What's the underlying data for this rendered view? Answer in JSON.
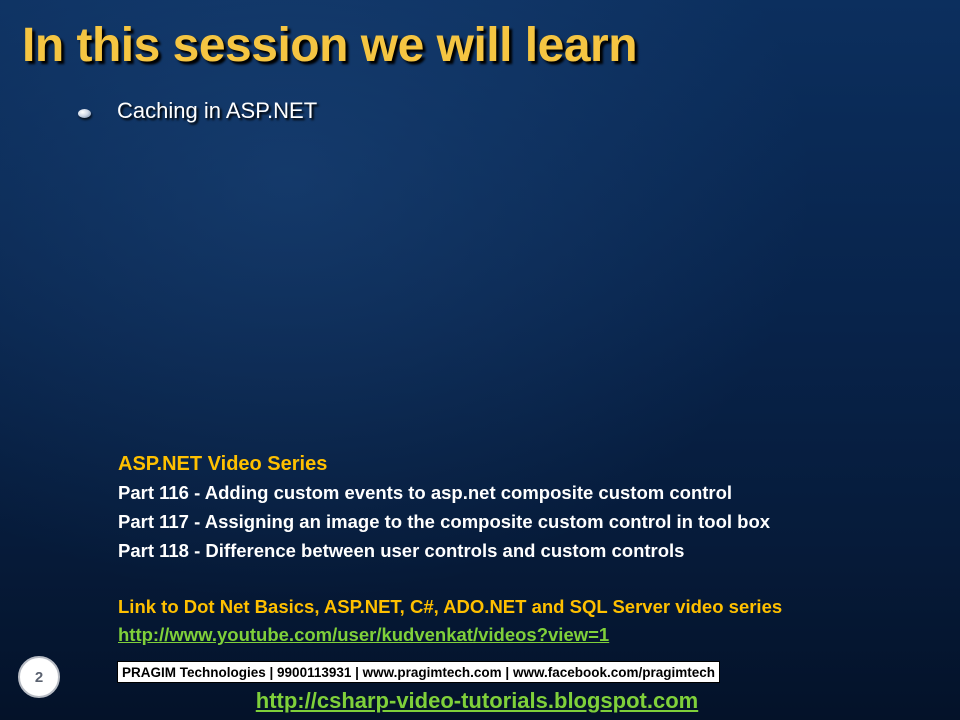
{
  "slide": {
    "title": "In this session we will learn",
    "bullets": [
      "Caching in ASP.NET"
    ],
    "series": {
      "heading": "ASP.NET Video Series",
      "parts": [
        "Part 116 - Adding custom events to asp.net composite custom control",
        "Part 117 - Assigning an image to the composite custom control in tool box",
        "Part 118 - Difference between user controls and custom controls"
      ],
      "link_caption": "Link to Dot Net Basics, ASP.NET, C#, ADO.NET and SQL Server video series",
      "youtube_url": "http://www.youtube.com/user/kudvenkat/videos?view=1"
    },
    "footer": {
      "slide_number": "2",
      "contact": "PRAGIM Technologies | 9900113931 | www.pragimtech.com | www.facebook.com/pragimtech",
      "blog_url": "http://csharp-video-tutorials.blogspot.com"
    }
  },
  "colors": {
    "title": "#f5c542",
    "heading": "#ffc000",
    "link": "#7fd03a",
    "background": "#0a2a56"
  }
}
